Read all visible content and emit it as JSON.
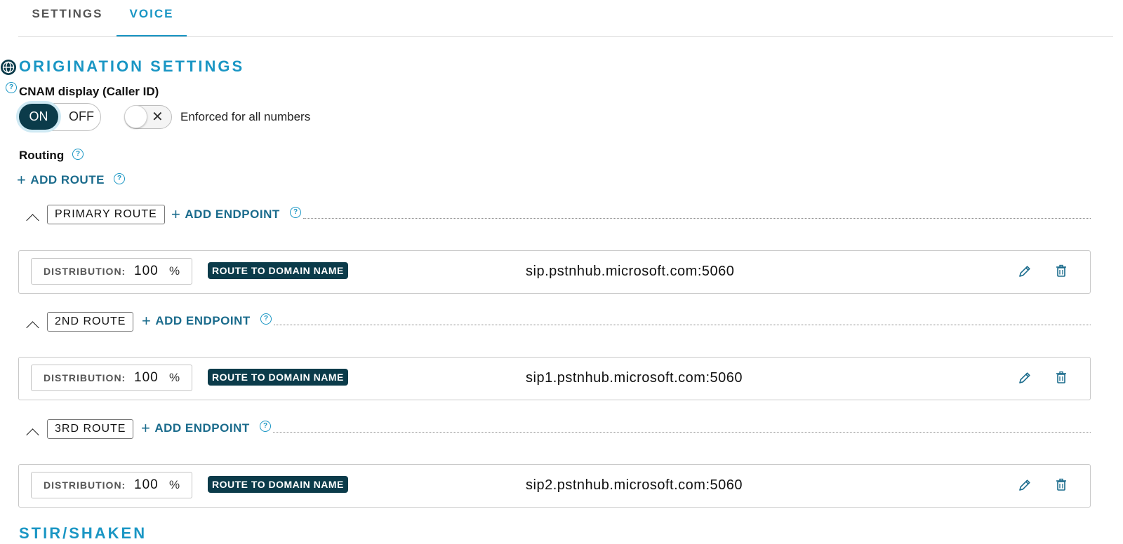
{
  "tabs": {
    "settings": "SETTINGS",
    "voice": "VOICE"
  },
  "origination": {
    "title": "ORIGINATION SETTINGS",
    "help_glyph": "?",
    "cnam_label": "CNAM display (Caller ID)",
    "toggle_on": "ON",
    "toggle_off": "OFF",
    "switch_x": "✕",
    "enforced_label": "Enforced for all numbers",
    "routing_label": "Routing",
    "add_route": "ADD ROUTE",
    "plus_glyph": "+",
    "routes": [
      {
        "name": "PRIMARY ROUTE",
        "add_endpoint": "ADD ENDPOINT",
        "distribution_label": "DISTRIBUTION:",
        "distribution": "100",
        "percent": "%",
        "badge": "ROUTE TO DOMAIN NAME",
        "domain": "sip.pstnhub.microsoft.com:5060"
      },
      {
        "name": "2ND ROUTE",
        "add_endpoint": "ADD ENDPOINT",
        "distribution_label": "DISTRIBUTION:",
        "distribution": "100",
        "percent": "%",
        "badge": "ROUTE TO DOMAIN NAME",
        "domain": "sip1.pstnhub.microsoft.com:5060"
      },
      {
        "name": "3RD ROUTE",
        "add_endpoint": "ADD ENDPOINT",
        "distribution_label": "DISTRIBUTION:",
        "distribution": "100",
        "percent": "%",
        "badge": "ROUTE TO DOMAIN NAME",
        "domain": "sip2.pstnhub.microsoft.com:5060"
      }
    ]
  },
  "next_section_title": "STIR/SHAKEN",
  "icons": {
    "globe": "globe-icon",
    "help": "help-circle-icon",
    "edit": "pencil-icon",
    "delete": "trash-icon",
    "collapse": "chevron-up-icon"
  },
  "colors": {
    "accent": "#1a96c4",
    "dark": "#0b3b4a",
    "link": "#1a6b8c"
  }
}
